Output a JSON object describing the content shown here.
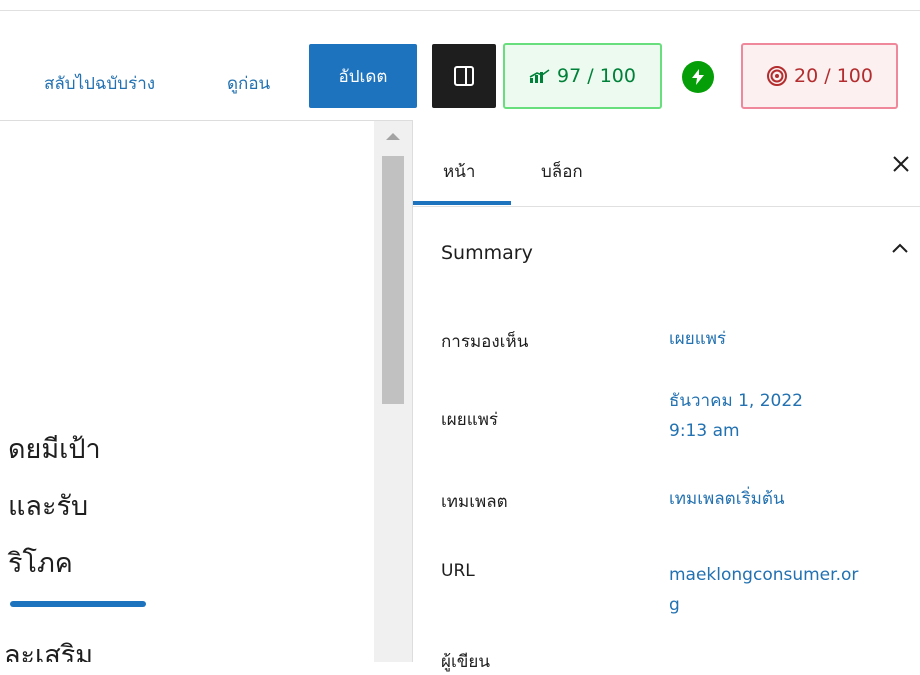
{
  "toolbar": {
    "switch_to_draft": "สลับไปฉบับร่าง",
    "preview": "ดูก่อน",
    "update": "อัปเดต",
    "seo_score": "97 / 100",
    "readability_score": "20 / 100",
    "icons": {
      "settings": "sidebar-toggle-icon",
      "seo": "chart-icon",
      "jetpack": "jetpack-bolt-icon",
      "readability": "fingerprint-icon"
    }
  },
  "content": {
    "lines": [
      "ดยมีเป้า",
      "และรับ",
      "ริโภค",
      "ละเสริม"
    ]
  },
  "sidebar": {
    "tabs": [
      "หน้า",
      "บล็อก"
    ],
    "active_tab": "หน้า",
    "panel_title": "Summary",
    "rows": [
      {
        "label": "การมองเห็น",
        "value": "เผยแพร่"
      },
      {
        "label": "เผยแพร่",
        "value_line1": "ธันวาคม 1, 2022",
        "value_line2": "9:13 am"
      },
      {
        "label": "เทมเพลต",
        "value": "เทมเพลตเริ่มต้น"
      },
      {
        "label": "URL",
        "value_line1": "maeklongconsumer.or",
        "value_line2": "g"
      },
      {
        "label": "ผู้เขียน"
      }
    ]
  },
  "colors": {
    "accent": "#1e73be",
    "link": "#2271b1",
    "seo_green": "#00813a",
    "readability_red": "#b32d2e"
  }
}
